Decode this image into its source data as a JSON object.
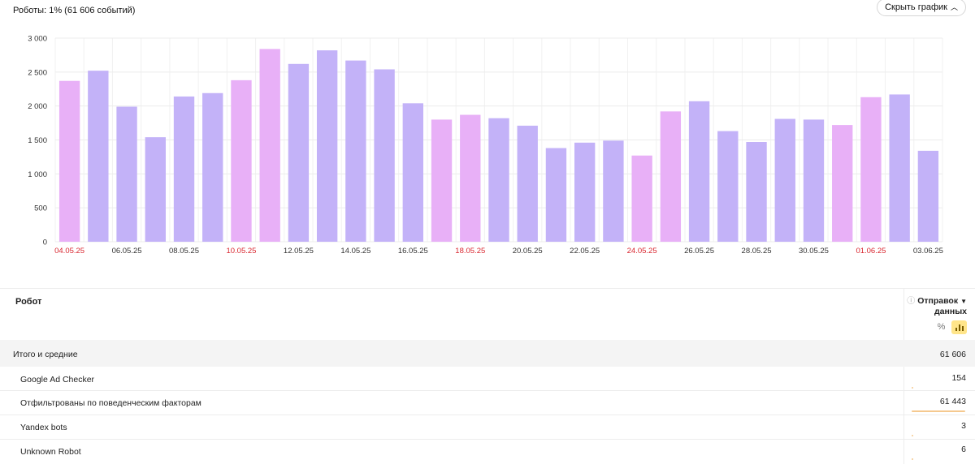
{
  "header": {
    "title": "Роботы: 1% (61 606 событий)",
    "hide_chart_label": "Скрыть график"
  },
  "colors": {
    "weekday_bar": "#c3b2f8",
    "weekend_bar": "#e8b0f7",
    "weekend_label": "#d9262f",
    "share_bar": "#f5c98f",
    "active_toggle": "#ffe58a"
  },
  "chart_data": {
    "type": "bar",
    "ylim": [
      0,
      3000
    ],
    "yticks": [
      "0",
      "500",
      "1 000",
      "1 500",
      "2 000",
      "2 500",
      "3 000"
    ],
    "grid": true,
    "x_tick_labels": [
      {
        "index": 0,
        "label": "04.05.25",
        "weekend": true
      },
      {
        "index": 2,
        "label": "06.05.25",
        "weekend": false
      },
      {
        "index": 4,
        "label": "08.05.25",
        "weekend": false
      },
      {
        "index": 6,
        "label": "10.05.25",
        "weekend": true
      },
      {
        "index": 8,
        "label": "12.05.25",
        "weekend": false
      },
      {
        "index": 10,
        "label": "14.05.25",
        "weekend": false
      },
      {
        "index": 12,
        "label": "16.05.25",
        "weekend": false
      },
      {
        "index": 14,
        "label": "18.05.25",
        "weekend": true
      },
      {
        "index": 16,
        "label": "20.05.25",
        "weekend": false
      },
      {
        "index": 18,
        "label": "22.05.25",
        "weekend": false
      },
      {
        "index": 20,
        "label": "24.05.25",
        "weekend": true
      },
      {
        "index": 22,
        "label": "26.05.25",
        "weekend": false
      },
      {
        "index": 24,
        "label": "28.05.25",
        "weekend": false
      },
      {
        "index": 26,
        "label": "30.05.25",
        "weekend": false
      },
      {
        "index": 28,
        "label": "01.06.25",
        "weekend": true
      },
      {
        "index": 30,
        "label": "03.06.25",
        "weekend": false
      }
    ],
    "values": [
      2370,
      2520,
      1990,
      1540,
      2140,
      2190,
      2380,
      2840,
      2620,
      2820,
      2670,
      2540,
      2040,
      1800,
      1870,
      1820,
      1710,
      1380,
      1460,
      1490,
      1270,
      1920,
      2070,
      1630,
      1470,
      1810,
      1800,
      1720,
      2130,
      2170,
      1340
    ],
    "weekend": [
      true,
      false,
      false,
      false,
      false,
      false,
      true,
      true,
      false,
      false,
      false,
      false,
      false,
      true,
      true,
      false,
      false,
      false,
      false,
      false,
      true,
      true,
      false,
      false,
      false,
      false,
      false,
      true,
      true,
      false,
      false
    ]
  },
  "table": {
    "col_robot": "Робот",
    "col_metric_line1": "Отправок",
    "col_metric_line2": "данных",
    "toggle_percent": "%",
    "total": {
      "name": "Итого и средние",
      "value": "61 606"
    },
    "rows": [
      {
        "name": "Google Ad Checker",
        "value": "154",
        "share": 0.0025
      },
      {
        "name": "Отфильтрованы по поведенческим факторам",
        "value": "61 443",
        "share": 0.9974
      },
      {
        "name": "Yandex bots",
        "value": "3",
        "share": 5e-05
      },
      {
        "name": "Unknown Robot",
        "value": "6",
        "share": 0.0001
      }
    ]
  }
}
